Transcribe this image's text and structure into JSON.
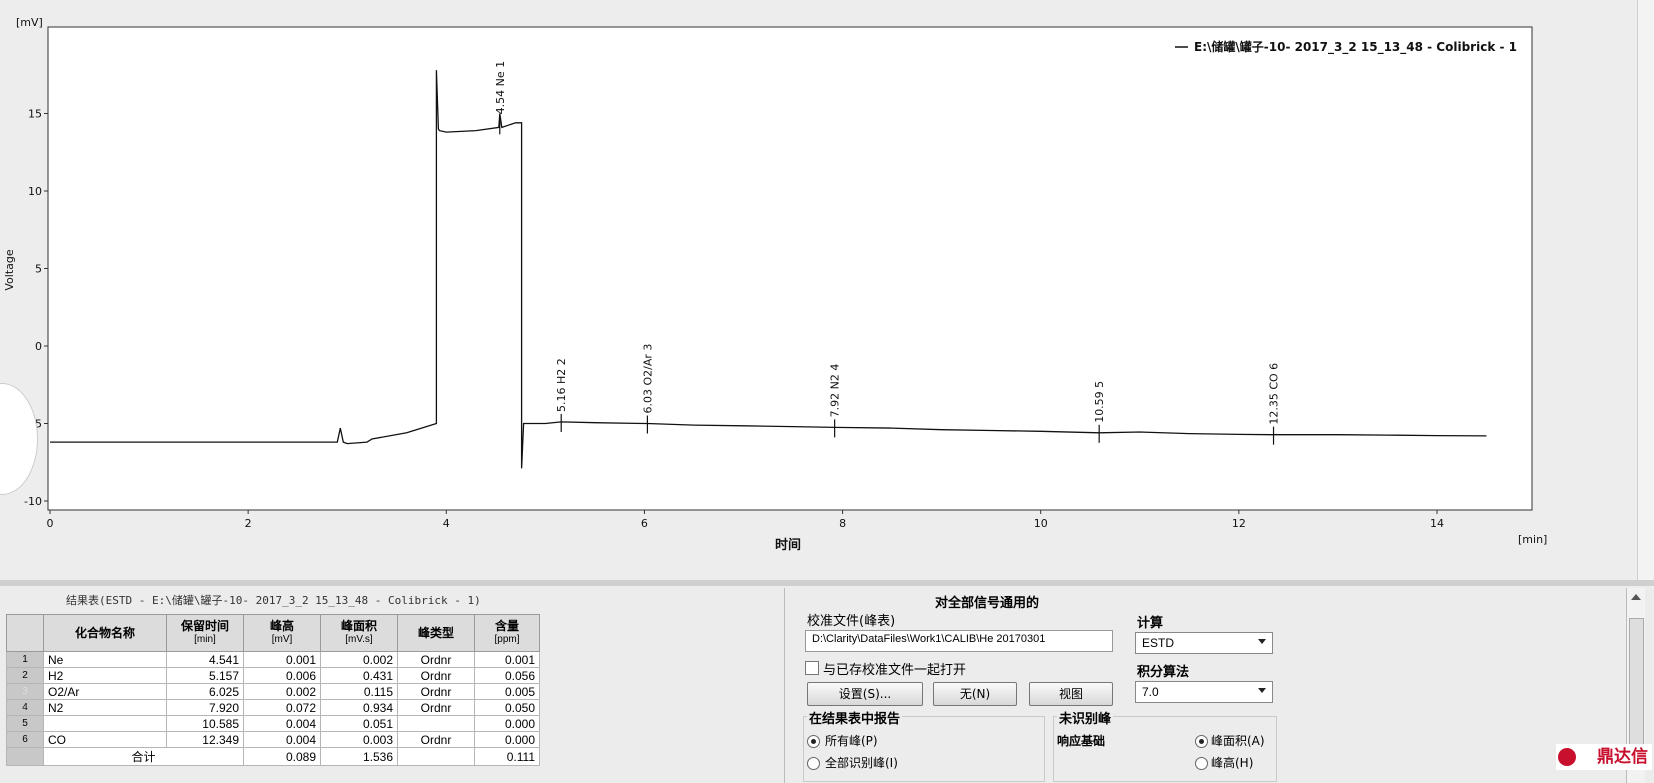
{
  "chart": {
    "y_unit": "[mV]",
    "x_unit": "[min]",
    "ylabel": "Voltage",
    "xlabel": "时间",
    "legend": "E:\\储罐\\罐子-10- 2017_3_2 15_13_48 - Colibrick - 1",
    "x_ticks": [
      "0",
      "2",
      "4",
      "6",
      "8",
      "10",
      "12",
      "14"
    ],
    "y_ticks": [
      "15",
      "10",
      "5",
      "0",
      "-5",
      "-10"
    ],
    "peak_labels": [
      "4.54 Ne  1",
      "5.16 H2  2",
      "6.03 O2/Ar  3",
      "7.92 N2  4",
      "10.59  5",
      "12.35 CO  6"
    ]
  },
  "chart_data": {
    "type": "line",
    "xlabel": "时间",
    "ylabel": "Voltage",
    "x_unit": "min",
    "y_unit": "mV",
    "xlim": [
      0,
      15
    ],
    "ylim": [
      -10.5,
      20.5
    ],
    "series": [
      {
        "name": "E:\\储罐\\罐子-10- 2017_3_2 15_13_48 - Colibrick - 1",
        "x": [
          0,
          2.9,
          2.93,
          2.96,
          3.0,
          3.2,
          3.25,
          3.6,
          3.9,
          3.9,
          3.92,
          3.93,
          4.0,
          4.3,
          4.53,
          4.54,
          4.56,
          4.7,
          4.76,
          4.76,
          4.78,
          4.8,
          4.98,
          5.0,
          5.16,
          5.5,
          6.0,
          6.03,
          6.5,
          7.0,
          7.5,
          7.92,
          8.5,
          9.0,
          9.5,
          10.0,
          10.59,
          11.0,
          11.5,
          12.0,
          12.35,
          13.0,
          13.5,
          14.0,
          14.5
        ],
        "y": [
          -6.2,
          -6.2,
          -5.3,
          -6.2,
          -6.3,
          -6.2,
          -6.0,
          -5.6,
          -5.0,
          17.8,
          14.0,
          13.9,
          13.8,
          13.9,
          14.1,
          15.0,
          14.1,
          14.4,
          14.4,
          -7.9,
          -5.0,
          -5.0,
          -5.0,
          -5.0,
          -4.9,
          -4.95,
          -5.0,
          -5.0,
          -5.1,
          -5.15,
          -5.2,
          -5.25,
          -5.3,
          -5.4,
          -5.45,
          -5.5,
          -5.6,
          -5.55,
          -5.65,
          -5.7,
          -5.72,
          -5.72,
          -5.75,
          -5.78,
          -5.8
        ]
      }
    ],
    "peaks": [
      {
        "rt": 4.54,
        "name": "Ne",
        "id": 1
      },
      {
        "rt": 5.16,
        "name": "H2",
        "id": 2
      },
      {
        "rt": 6.03,
        "name": "O2/Ar",
        "id": 3
      },
      {
        "rt": 7.92,
        "name": "N2",
        "id": 4
      },
      {
        "rt": 10.59,
        "name": "",
        "id": 5
      },
      {
        "rt": 12.35,
        "name": "CO",
        "id": 6
      }
    ],
    "grid": false,
    "legend_position": "top-right"
  },
  "results": {
    "title": "结果表(ESTD - E:\\储罐\\罐子-10- 2017_3_2 15_13_48 - Colibrick - 1)",
    "headers": [
      {
        "label": "化合物名称",
        "unit": ""
      },
      {
        "label": "保留时间",
        "unit": "[min]"
      },
      {
        "label": "峰高",
        "unit": "[mV]"
      },
      {
        "label": "峰面积",
        "unit": "[mV.s]"
      },
      {
        "label": "峰类型",
        "unit": ""
      },
      {
        "label": "含量",
        "unit": "[ppm]"
      }
    ],
    "rows": [
      {
        "no": "1",
        "name": "Ne",
        "rt": "4.541",
        "height": "0.001",
        "area": "0.002",
        "type": "Ordnr",
        "amount": "0.001"
      },
      {
        "no": "2",
        "name": "H2",
        "rt": "5.157",
        "height": "0.006",
        "area": "0.431",
        "type": "Ordnr",
        "amount": "0.056"
      },
      {
        "no": "3",
        "name": "O2/Ar",
        "rt": "6.025",
        "height": "0.002",
        "area": "0.115",
        "type": "Ordnr",
        "amount": "0.005"
      },
      {
        "no": "4",
        "name": "N2",
        "rt": "7.920",
        "height": "0.072",
        "area": "0.934",
        "type": "Ordnr",
        "amount": "0.050"
      },
      {
        "no": "5",
        "name": "",
        "rt": "10.585",
        "height": "0.004",
        "area": "0.051",
        "type": "",
        "amount": "0.000"
      },
      {
        "no": "6",
        "name": "CO",
        "rt": "12.349",
        "height": "0.004",
        "area": "0.003",
        "type": "Ordnr",
        "amount": "0.000"
      }
    ],
    "total": {
      "label": "合计",
      "height": "0.089",
      "area": "1.536",
      "amount": "0.111"
    }
  },
  "calib": {
    "panel_title": "对全部信号通用的",
    "file_label": "校准文件(峰表)",
    "file_path": "D:\\Clarity\\DataFiles\\Work1\\CALIB\\He 20170301",
    "open_with_label": "与已存校准文件一起打开",
    "btn_setup": "设置(S)...",
    "btn_none": "无(N)",
    "btn_view": "视图",
    "calc_label": "计算",
    "calc_value": "ESTD",
    "integ_label": "积分算法",
    "integ_value": "7.0",
    "report_group": "在结果表中报告",
    "report_all": "所有峰(P)",
    "report_identified": "全部识别峰(I)",
    "unident_group": "未识别峰",
    "response_label": "响应基础",
    "resp_area": "峰面积(A)",
    "resp_height": "峰高(H)"
  },
  "logo": {
    "text": "鼎达信",
    "color": "#c8102e"
  }
}
